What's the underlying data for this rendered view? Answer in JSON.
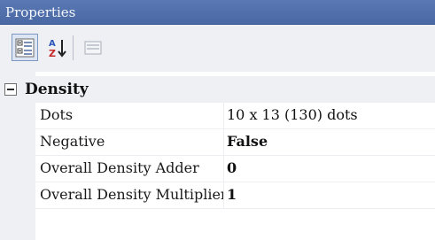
{
  "panel": {
    "title": "Properties"
  },
  "toolbar": {
    "buttons": [
      {
        "icon": "categorized-icon",
        "active": true
      },
      {
        "icon": "sort-az-icon",
        "active": false
      },
      {
        "icon": "property-pages-icon",
        "active": false,
        "disabled": true
      }
    ]
  },
  "category": {
    "label": "Density",
    "expanded": true
  },
  "properties": [
    {
      "name": "Dots",
      "value": "10 x 13 (130) dots",
      "bold": false
    },
    {
      "name": "Negative",
      "value": "False",
      "bold": true
    },
    {
      "name": "Overall Density Adder",
      "value": "0",
      "bold": true
    },
    {
      "name": "Overall Density Multiplier",
      "value": "1",
      "bold": true
    }
  ],
  "colors": {
    "title_bar": "#4a68a4",
    "toolbar_bg": "#eef0f4",
    "grid_line": "#eceef2"
  }
}
